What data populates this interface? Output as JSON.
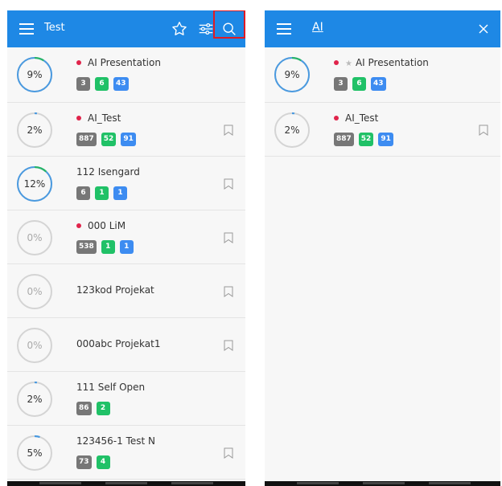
{
  "left": {
    "title": "Test",
    "icons": [
      "menu-icon",
      "star-icon",
      "filter-icon",
      "search-icon"
    ],
    "rows": [
      {
        "pct": "9%",
        "progress": 0.09,
        "name": "AI Presentation",
        "dot": true,
        "badges": [
          "3",
          "6",
          "43"
        ],
        "bookmark": false
      },
      {
        "pct": "2%",
        "progress": 0.02,
        "name": "AI_Test",
        "dot": true,
        "badges": [
          "887",
          "52",
          "91"
        ],
        "bookmark": true
      },
      {
        "pct": "12%",
        "progress": 0.12,
        "name": "112 Isengard",
        "dot": false,
        "badges": [
          "6",
          "1",
          "1"
        ],
        "bookmark": true
      },
      {
        "pct": "0%",
        "progress": 0,
        "name": "000 LiM",
        "dot": true,
        "badges": [
          "538",
          "1",
          "1"
        ],
        "bookmark": true
      },
      {
        "pct": "0%",
        "progress": 0,
        "name": "123kod Projekat",
        "dot": false,
        "badges": [],
        "bookmark": true
      },
      {
        "pct": "0%",
        "progress": 0,
        "name": "000abc Projekat1",
        "dot": false,
        "badges": [],
        "bookmark": true
      },
      {
        "pct": "2%",
        "progress": 0.02,
        "name": "111 Self Open",
        "dot": false,
        "badges": [
          "86",
          "2"
        ],
        "bookmark": false
      },
      {
        "pct": "5%",
        "progress": 0.05,
        "name": "123456-1 Test N",
        "dot": false,
        "badges": [
          "73",
          "4"
        ],
        "bookmark": true
      }
    ]
  },
  "right": {
    "search_text": "AI",
    "icons": [
      "menu-icon",
      "close-icon"
    ],
    "rows": [
      {
        "pct": "9%",
        "progress": 0.09,
        "name": "AI Presentation",
        "dot": true,
        "star": true,
        "badges": [
          "3",
          "6",
          "43"
        ],
        "bookmark": false
      },
      {
        "pct": "2%",
        "progress": 0.02,
        "name": "AI_Test",
        "dot": true,
        "star": false,
        "badges": [
          "887",
          "52",
          "91"
        ],
        "bookmark": true
      }
    ]
  },
  "colors": {
    "accent": "#1e88e5",
    "dot": "#e0244b",
    "gray": "#777777",
    "green": "#20c167",
    "blue": "#3d8cf1",
    "highlight": "#e01b24"
  }
}
